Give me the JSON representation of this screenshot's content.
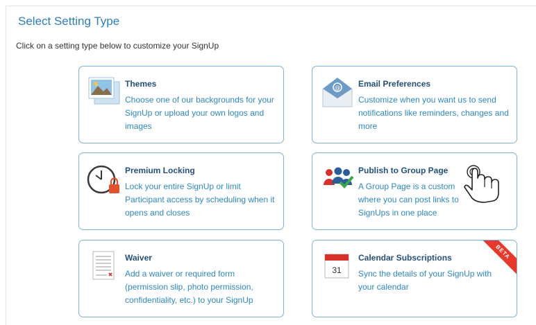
{
  "header": {
    "title": "Select Setting Type",
    "subtitle": "Click on a setting type below to customize your SignUp"
  },
  "cards": [
    {
      "title": "Themes",
      "description": "Choose one of our backgrounds for your SignUp or upload your own logos and images",
      "icon": "themes-image-icon"
    },
    {
      "title": "Email Preferences",
      "description": "Customize when you want us to send notifications like reminders, changes and more",
      "icon": "email-envelope-icon"
    },
    {
      "title": "Premium Locking",
      "description": "Lock your entire SignUp or limit Participant access by scheduling when it opens and closes",
      "icon": "clock-lock-icon"
    },
    {
      "title": "Publish to Group Page",
      "description": "A Group Page is a custom... where you can post links to ... e SignUps in one place",
      "description_lines": [
        "A Group Page is a custom",
        "where you can post links to",
        "SignUps in one place"
      ],
      "icon": "group-people-icon"
    },
    {
      "title": "Waiver",
      "description": "Add a waiver or required form (permission slip, photo permission, confidentiality, etc.) to your SignUp",
      "icon": "document-waiver-icon"
    },
    {
      "title": "Calendar Subscriptions",
      "description": "Sync the details of your SignUp with your calendar",
      "icon": "calendar-icon",
      "badge": "BETA",
      "calendar_day": "31"
    }
  ],
  "colors": {
    "accent": "#2d7fb8",
    "card_border": "#7db4dc",
    "card_title": "#23507c",
    "card_text": "#2d88c2",
    "beta": "#e8382b"
  }
}
